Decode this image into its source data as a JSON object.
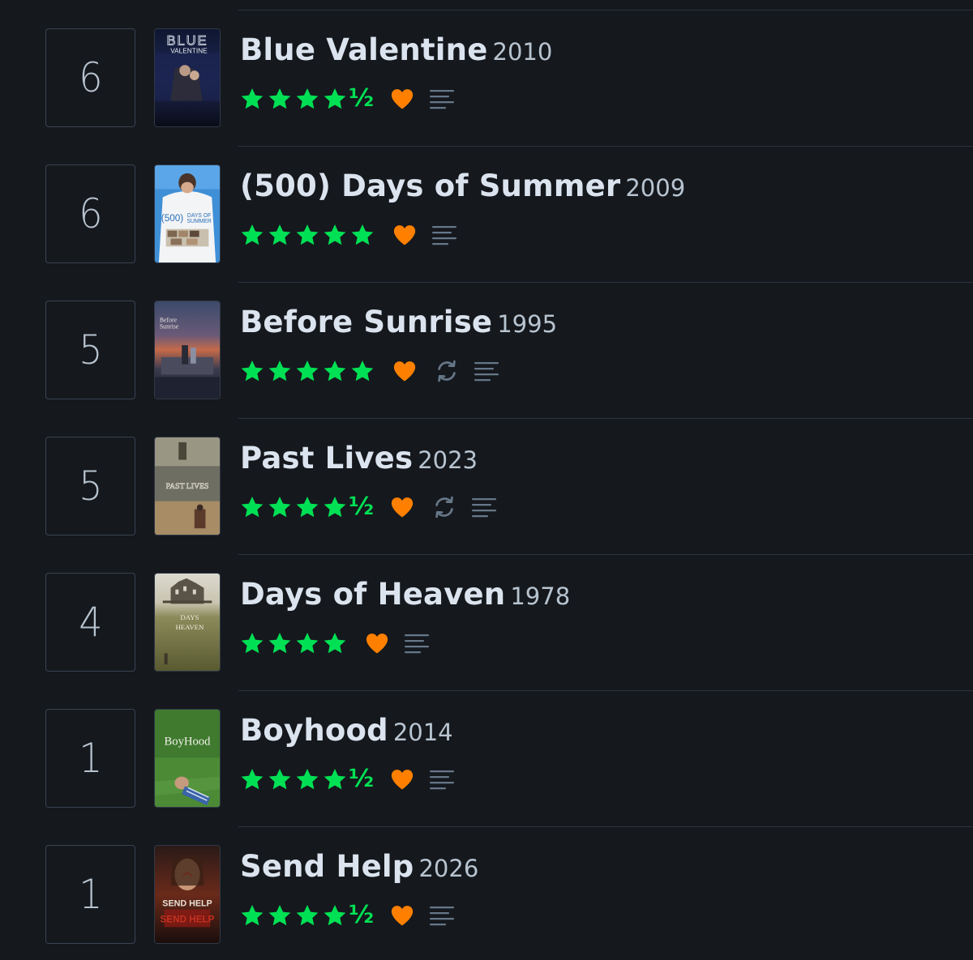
{
  "colors": {
    "background": "#15181d",
    "star": "#00e054",
    "heart": "#ff8000",
    "muted_icon": "#667788",
    "title": "#dbe4ee",
    "year": "#b8c4d0"
  },
  "entries": [
    {
      "rank": "6",
      "title": "Blue Valentine",
      "year": "2010",
      "rating": 4.5,
      "half_symbol": "½",
      "liked": true,
      "rewatch": false,
      "review": true,
      "poster_text": [
        "BLUE",
        "VALENTINE"
      ]
    },
    {
      "rank": "6",
      "title": "(500) Days of Summer",
      "year": "2009",
      "rating": 5,
      "half_symbol": "",
      "liked": true,
      "rewatch": false,
      "review": true,
      "poster_text": [
        "(500)",
        "DAYS OF",
        "SUMMER"
      ]
    },
    {
      "rank": "5",
      "title": "Before Sunrise",
      "year": "1995",
      "rating": 5,
      "half_symbol": "",
      "liked": true,
      "rewatch": true,
      "review": true,
      "poster_text": [
        "Before",
        "Sunrise"
      ]
    },
    {
      "rank": "5",
      "title": "Past Lives",
      "year": "2023",
      "rating": 4.5,
      "half_symbol": "½",
      "liked": true,
      "rewatch": true,
      "review": true,
      "poster_text": [
        "PAST LIVES"
      ]
    },
    {
      "rank": "4",
      "title": "Days of Heaven",
      "year": "1978",
      "rating": 4,
      "half_symbol": "",
      "liked": true,
      "rewatch": false,
      "review": true,
      "poster_text": [
        "DAYS",
        "HEAVEN"
      ]
    },
    {
      "rank": "1",
      "title": "Boyhood",
      "year": "2014",
      "rating": 4.5,
      "half_symbol": "½",
      "liked": true,
      "rewatch": false,
      "review": true,
      "poster_text": [
        "BoyHood"
      ]
    },
    {
      "rank": "1",
      "title": "Send Help",
      "year": "2026",
      "rating": 4.5,
      "half_symbol": "½",
      "liked": true,
      "rewatch": false,
      "review": true,
      "poster_text": [
        "SEND HELP"
      ]
    }
  ]
}
